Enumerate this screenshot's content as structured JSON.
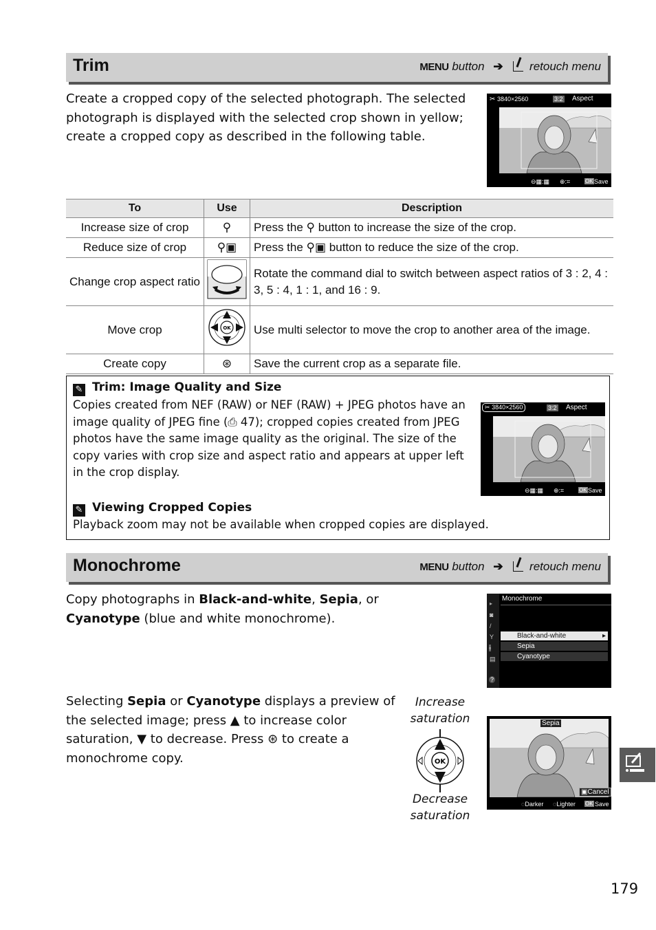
{
  "trim": {
    "title": "Trim",
    "path": {
      "menu": "MENU",
      "button": "button",
      "arrow": "➔",
      "retouch": "retouch menu"
    },
    "intro": "Create a cropped copy of the selected photograph.  The selected photograph is displayed with the selected crop shown in yellow; create a cropped copy as described in the following table.",
    "screen": {
      "size": "3840×2560",
      "aspect_ratio": "3:2",
      "aspect_label": "Aspect",
      "footer_save": "Save",
      "ok": "OK"
    },
    "table": {
      "headers": [
        "To",
        "Use",
        "Description"
      ],
      "rows": [
        {
          "to": "Increase size of crop",
          "use_icon": "zoom-in-icon",
          "desc_pre": "Press the ",
          "desc_post": " button to increase the size of the crop."
        },
        {
          "to": "Reduce size of crop",
          "use_icon": "zoom-out-thumbnail-icon",
          "desc_pre": "Press the ",
          "desc_post": " button to reduce the size of the crop."
        },
        {
          "to": "Change crop aspect ratio",
          "use_icon": "command-dial-icon",
          "desc": "Rotate the command dial to switch between aspect ratios of 3 : 2, 4 : 3, 5 : 4, 1 : 1, and 16 : 9."
        },
        {
          "to": "Move crop",
          "use_icon": "multi-selector-icon",
          "desc": "Use multi selector to move the crop to another area of the image."
        },
        {
          "to": "Create copy",
          "use_icon": "ok-button-icon",
          "desc": "Save the current crop as a separate file."
        }
      ]
    }
  },
  "notes": [
    {
      "title": "Trim: Image Quality and Size",
      "body": "Copies created from NEF (RAW) or NEF (RAW) + JPEG photos have an image quality of JPEG fine (⎙ 47); cropped copies created from JPEG photos have the same image quality as the original.  The size of the copy varies with crop size and aspect ratio and appears at upper left in the crop display."
    },
    {
      "title": "Viewing Cropped Copies",
      "body": "Playback zoom may not be available when cropped copies are displayed."
    }
  ],
  "monochrome": {
    "title": "Monochrome",
    "path": {
      "menu": "MENU",
      "button": "button",
      "arrow": "➔",
      "retouch": "retouch menu"
    },
    "intro": {
      "pre": "Copy photographs in ",
      "b1": "Black-and-white",
      "m1": ", ",
      "b2": "Sepia",
      "m2": ", or ",
      "b3": "Cyanotype",
      "post": " (blue and white monochrome)."
    },
    "para2": {
      "pre": "Selecting ",
      "b1": "Sepia",
      "m1": " or ",
      "b2": "Cyanotype",
      "m2": " displays a preview of the selected image; press ▲ to increase color saturation, ▼ to decrease.  Press ",
      "ok": "⊛",
      "post": " to create a monochrome copy."
    },
    "menu_screen": {
      "title": "Monochrome",
      "items": [
        "Black-and-white",
        "Sepia",
        "Cyanotype"
      ],
      "selected": 0,
      "help": "?"
    },
    "caption_up": "Increase saturation",
    "caption_down": "Decrease saturation",
    "preview_screen": {
      "label": "Sepia",
      "cancel": "Cancel",
      "darker": "Darker",
      "lighter": "Lighter",
      "save": "Save",
      "ok": "OK"
    }
  },
  "page_number": "179"
}
